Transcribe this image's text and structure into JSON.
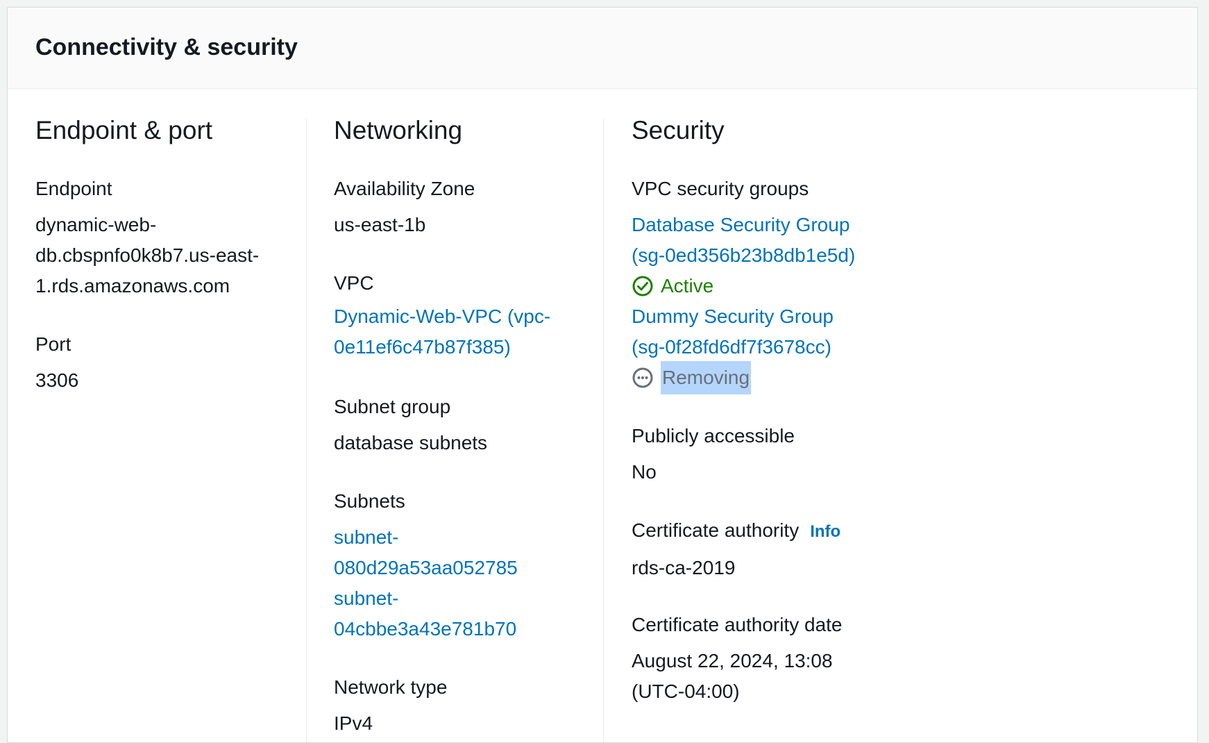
{
  "panel": {
    "title": "Connectivity & security"
  },
  "endpoint_port": {
    "title": "Endpoint & port",
    "endpoint_label": "Endpoint",
    "endpoint_value_lines": [
      "dynamic-web-",
      "db.cbspnfo0k8b7.us-east-",
      "1.rds.amazonaws.com"
    ],
    "port_label": "Port",
    "port_value": "3306"
  },
  "networking": {
    "title": "Networking",
    "az_label": "Availability Zone",
    "az_value": "us-east-1b",
    "vpc_label": "VPC",
    "vpc_link_lines": [
      "Dynamic-Web-VPC (vpc-",
      "0e11ef6c47b87f385)"
    ],
    "subnet_group_label": "Subnet group",
    "subnet_group_value": "database subnets",
    "subnets_label": "Subnets",
    "subnets": [
      {
        "lines": [
          "subnet-",
          "080d29a53aa052785"
        ]
      },
      {
        "lines": [
          "subnet-",
          "04cbbe3a43e781b70"
        ]
      }
    ],
    "network_type_label": "Network type",
    "network_type_value": "IPv4"
  },
  "security": {
    "title": "Security",
    "vpc_sg_label": "VPC security groups",
    "groups": [
      {
        "name_lines": [
          "Database Security Group",
          "(sg-0ed356b23b8db1e5d)"
        ],
        "status": "Active",
        "status_icon": "check-circle-icon",
        "status_color": "#1d8102"
      },
      {
        "name_lines": [
          "Dummy Security Group",
          "(sg-0f28fd6df7f3678cc)"
        ],
        "status": "Removing",
        "status_icon": "ellipsis-circle-icon",
        "status_color": "#687078"
      }
    ],
    "public_label": "Publicly accessible",
    "public_value": "No",
    "ca_label": "Certificate authority",
    "ca_info": "Info",
    "ca_value": "rds-ca-2019",
    "ca_date_label": "Certificate authority date",
    "ca_date_lines": [
      "August 22, 2024, 13:08",
      "(UTC-04:00)"
    ]
  }
}
